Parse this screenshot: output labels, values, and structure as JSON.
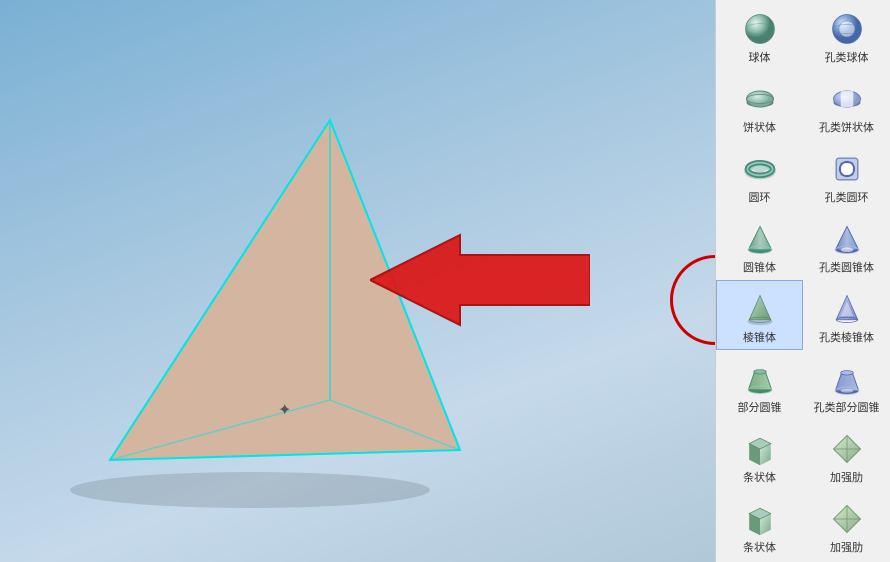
{
  "viewport": {
    "background_description": "3D CAD viewport with blue-gray gradient background",
    "pyramid_description": "3D pyramid shape selected with cyan highlight edges"
  },
  "arrow": {
    "color": "#cc0000",
    "direction": "left"
  },
  "circle": {
    "color": "#cc0000"
  },
  "sidebar": {
    "items": [
      {
        "id": "qiuti",
        "label": "球体",
        "icon": "sphere"
      },
      {
        "id": "konglei-qiuti",
        "label": "孔类球体",
        "icon": "sphere-hollow"
      },
      {
        "id": "bingzhuang",
        "label": "饼状体",
        "icon": "disk"
      },
      {
        "id": "konglei-bingzhuang",
        "label": "孔类饼状体",
        "icon": "disk-hollow"
      },
      {
        "id": "yuanhuan",
        "label": "圆环",
        "icon": "torus"
      },
      {
        "id": "konglei-yuanhuan",
        "label": "孔类圆环",
        "icon": "torus-hollow"
      },
      {
        "id": "yuanzhui",
        "label": "圆锥体",
        "icon": "cone"
      },
      {
        "id": "konglei-yuanzhui",
        "label": "孔类圆锥体",
        "icon": "cone-hollow"
      },
      {
        "id": "lenzhui",
        "label": "棱锥体",
        "icon": "pyramid",
        "active": true
      },
      {
        "id": "konglei-lenzhui",
        "label": "孔类棱锥体",
        "icon": "pyramid-hollow"
      },
      {
        "id": "bufenyuanzhui",
        "label": "部分圆锥",
        "icon": "partial-cone"
      },
      {
        "id": "konglei-bufenyuanzhui",
        "label": "孔类部分圆锥",
        "icon": "partial-cone-hollow"
      },
      {
        "id": "tiaozhuang",
        "label": "条状体",
        "icon": "bar"
      },
      {
        "id": "jiaqiangjin",
        "label": "加强肋",
        "icon": "rib"
      },
      {
        "id": "tiaozhuang2",
        "label": "条状体",
        "icon": "bar2"
      },
      {
        "id": "jiaqiangjin2",
        "label": "加强肋",
        "icon": "rib2"
      }
    ]
  }
}
